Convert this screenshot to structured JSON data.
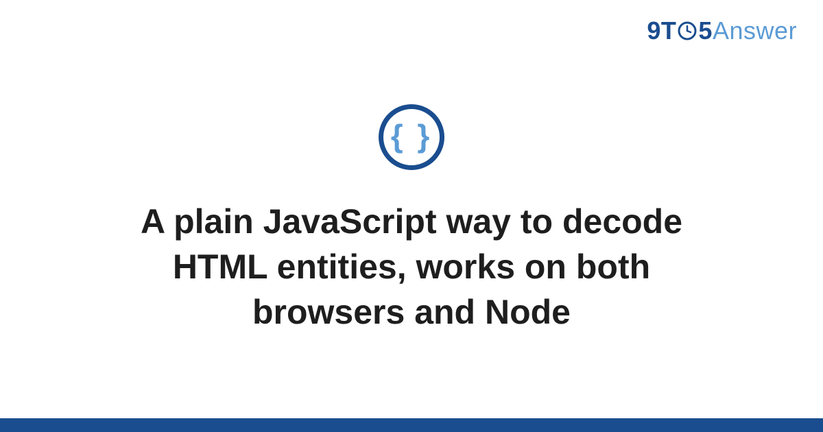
{
  "logo": {
    "prefix": "9T",
    "middle": "5",
    "suffix": "Answer"
  },
  "icon": {
    "symbol": "{ }",
    "name": "code-braces"
  },
  "title": "A plain JavaScript way to decode HTML entities, works on both browsers and Node",
  "colors": {
    "brand_dark": "#1a4d8f",
    "brand_light": "#5b9bd5",
    "text": "#1e1e1e",
    "background": "#ffffff"
  }
}
